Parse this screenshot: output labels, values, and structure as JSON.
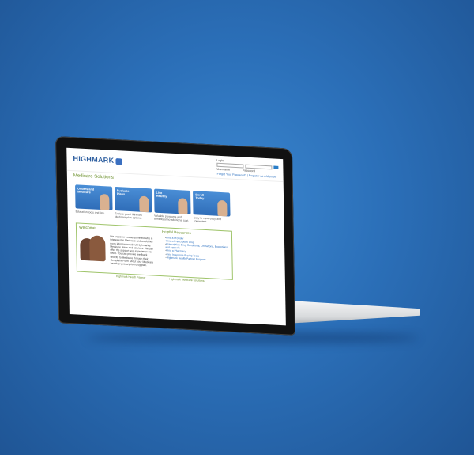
{
  "site": {
    "logo": "HIGHMARK",
    "login": {
      "title": "Login",
      "username_label": "Username",
      "password_label": "Password",
      "links": "Forgot Your Password? | Register As A Member"
    },
    "page_title": "Medicare Solutions",
    "tiles": [
      {
        "title": "Understand Medicare",
        "caption": "Education tools and tips."
      },
      {
        "title": "Evaluate Plans",
        "caption": "Explore your Highmark Medicare plan options."
      },
      {
        "title": "Live Healthy",
        "caption": "Valuable programs and benefits at no additional cost."
      },
      {
        "title": "Enroll Today",
        "caption": "Easy to view, easy, and convenient."
      }
    ],
    "welcome": {
      "heading": "Welcome",
      "text": "We welcome you as someone who is interested in Medicare and would like more information about Highmark's Medicare plans and services. We can offer the support and experience you need. You can provide feedback directly to Medicare through their Complaint Form about your Medicare health or prescription drug plan."
    },
    "resources": {
      "heading": "Helpful Resources",
      "items": [
        "Find a Provider",
        "Find a Prescription Drug",
        "Prescription Drug Conditions, Limitations, Exceptions and Appeals",
        "Find a Pharmacy",
        "Find Insurance Buying Tools",
        "Highmark Health Partner Program"
      ]
    },
    "footer": [
      "Highmark Health Partner",
      "Highmark Medicare Solutions"
    ]
  }
}
